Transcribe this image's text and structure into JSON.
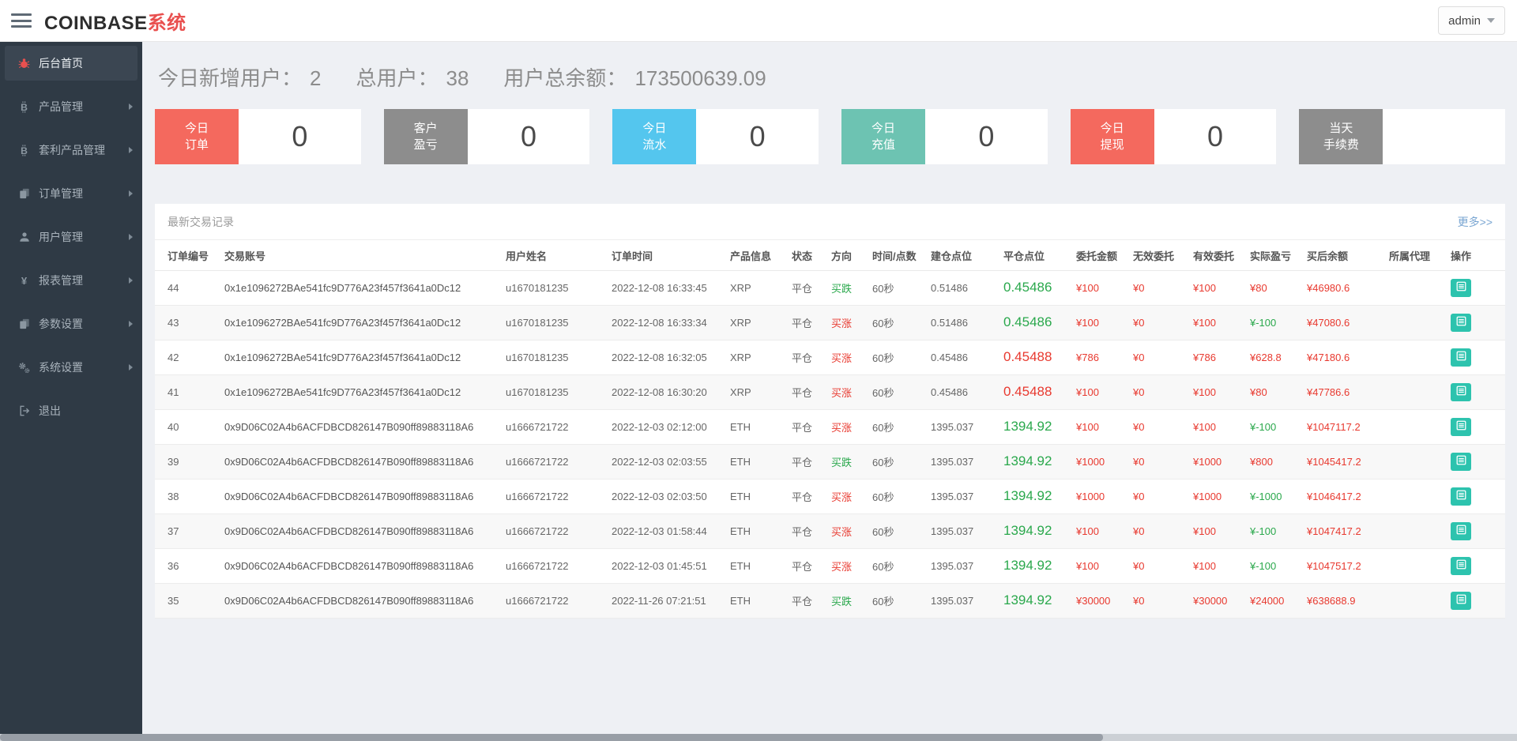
{
  "colors": {
    "accent_red": "#e9504f",
    "cell_red": "#e8392f",
    "cell_green": "#2aa84c",
    "action_teal": "#2dc3ae",
    "link_blue": "#7aa6d2",
    "card_red": "#f4695e",
    "card_gray": "#8d8d8d",
    "card_blue": "#54c6ee",
    "card_teal": "#6dc3b2"
  },
  "header": {
    "brand_main": "COINBASE",
    "brand_suffix": "系统",
    "user_menu_label": "admin"
  },
  "sidebar": {
    "items": [
      {
        "label": "后台首页",
        "icon": "bug-icon",
        "active": true,
        "arrow": false
      },
      {
        "label": "产品管理",
        "icon": "bitcoin-icon",
        "active": false,
        "arrow": true
      },
      {
        "label": "套利产品管理",
        "icon": "bitcoin-icon",
        "active": false,
        "arrow": true
      },
      {
        "label": "订单管理",
        "icon": "copy-icon",
        "active": false,
        "arrow": true
      },
      {
        "label": "用户管理",
        "icon": "user-icon",
        "active": false,
        "arrow": true
      },
      {
        "label": "报表管理",
        "icon": "yen-icon",
        "active": false,
        "arrow": true
      },
      {
        "label": "参数设置",
        "icon": "copy-icon",
        "active": false,
        "arrow": true
      },
      {
        "label": "系统设置",
        "icon": "gear-icon",
        "active": false,
        "arrow": true
      },
      {
        "label": "退出",
        "icon": "logout-icon",
        "active": false,
        "arrow": false
      }
    ]
  },
  "summary": {
    "items": [
      {
        "label": "今日新增用户：",
        "value": "2"
      },
      {
        "label": "总用户：",
        "value": "38"
      },
      {
        "label": "用户总余额：",
        "value": "173500639.09"
      }
    ]
  },
  "cards": [
    {
      "line1": "今日",
      "line2": "订单",
      "value": "0",
      "color": "#f4695e"
    },
    {
      "line1": "客户",
      "line2": "盈亏",
      "value": "0",
      "color": "#8d8d8d"
    },
    {
      "line1": "今日",
      "line2": "流水",
      "value": "0",
      "color": "#54c6ee"
    },
    {
      "line1": "今日",
      "line2": "充值",
      "value": "0",
      "color": "#6dc3b2"
    },
    {
      "line1": "今日",
      "line2": "提现",
      "value": "0",
      "color": "#f4695e"
    },
    {
      "line1": "当天",
      "line2": "手续费",
      "value": "",
      "color": "#8d8d8d"
    }
  ],
  "table": {
    "title": "最新交易记录",
    "more_label": "更多>>",
    "columns": [
      "订单编号",
      "交易账号",
      "用户姓名",
      "订单时间",
      "产品信息",
      "状态",
      "方向",
      "时间/点数",
      "建仓点位",
      "平仓点位",
      "委托金额",
      "无效委托",
      "有效委托",
      "实际盈亏",
      "买后余额",
      "所属代理",
      "操作"
    ],
    "rows": [
      {
        "id": "44",
        "account": "0x1e1096272BAe541fc9D776A23f457f3641a0Dc12",
        "name": "u1670181235",
        "time": "2022-12-08 16:33:45",
        "product": "XRP",
        "status": "平仓",
        "dir": "买跌",
        "dir_color": "green",
        "duration": "60秒",
        "open": "0.51486",
        "close": "0.45486",
        "close_color": "green",
        "amount": "¥100",
        "invalid": "¥0",
        "valid": "¥100",
        "profit": "¥80",
        "profit_color": "red",
        "balance": "¥46980.6",
        "agent": ""
      },
      {
        "id": "43",
        "account": "0x1e1096272BAe541fc9D776A23f457f3641a0Dc12",
        "name": "u1670181235",
        "time": "2022-12-08 16:33:34",
        "product": "XRP",
        "status": "平仓",
        "dir": "买涨",
        "dir_color": "red",
        "duration": "60秒",
        "open": "0.51486",
        "close": "0.45486",
        "close_color": "green",
        "amount": "¥100",
        "invalid": "¥0",
        "valid": "¥100",
        "profit": "¥-100",
        "profit_color": "green",
        "balance": "¥47080.6",
        "agent": ""
      },
      {
        "id": "42",
        "account": "0x1e1096272BAe541fc9D776A23f457f3641a0Dc12",
        "name": "u1670181235",
        "time": "2022-12-08 16:32:05",
        "product": "XRP",
        "status": "平仓",
        "dir": "买涨",
        "dir_color": "red",
        "duration": "60秒",
        "open": "0.45486",
        "close": "0.45488",
        "close_color": "red",
        "amount": "¥786",
        "invalid": "¥0",
        "valid": "¥786",
        "profit": "¥628.8",
        "profit_color": "red",
        "balance": "¥47180.6",
        "agent": ""
      },
      {
        "id": "41",
        "account": "0x1e1096272BAe541fc9D776A23f457f3641a0Dc12",
        "name": "u1670181235",
        "time": "2022-12-08 16:30:20",
        "product": "XRP",
        "status": "平仓",
        "dir": "买涨",
        "dir_color": "red",
        "duration": "60秒",
        "open": "0.45486",
        "close": "0.45488",
        "close_color": "red",
        "amount": "¥100",
        "invalid": "¥0",
        "valid": "¥100",
        "profit": "¥80",
        "profit_color": "red",
        "balance": "¥47786.6",
        "agent": ""
      },
      {
        "id": "40",
        "account": "0x9D06C02A4b6ACFDBCD826147B090ff89883118A6",
        "name": "u1666721722",
        "time": "2022-12-03 02:12:00",
        "product": "ETH",
        "status": "平仓",
        "dir": "买涨",
        "dir_color": "red",
        "duration": "60秒",
        "open": "1395.037",
        "close": "1394.92",
        "close_color": "green",
        "amount": "¥100",
        "invalid": "¥0",
        "valid": "¥100",
        "profit": "¥-100",
        "profit_color": "green",
        "balance": "¥1047117.2",
        "agent": ""
      },
      {
        "id": "39",
        "account": "0x9D06C02A4b6ACFDBCD826147B090ff89883118A6",
        "name": "u1666721722",
        "time": "2022-12-03 02:03:55",
        "product": "ETH",
        "status": "平仓",
        "dir": "买跌",
        "dir_color": "green",
        "duration": "60秒",
        "open": "1395.037",
        "close": "1394.92",
        "close_color": "green",
        "amount": "¥1000",
        "invalid": "¥0",
        "valid": "¥1000",
        "profit": "¥800",
        "profit_color": "red",
        "balance": "¥1045417.2",
        "agent": ""
      },
      {
        "id": "38",
        "account": "0x9D06C02A4b6ACFDBCD826147B090ff89883118A6",
        "name": "u1666721722",
        "time": "2022-12-03 02:03:50",
        "product": "ETH",
        "status": "平仓",
        "dir": "买涨",
        "dir_color": "red",
        "duration": "60秒",
        "open": "1395.037",
        "close": "1394.92",
        "close_color": "green",
        "amount": "¥1000",
        "invalid": "¥0",
        "valid": "¥1000",
        "profit": "¥-1000",
        "profit_color": "green",
        "balance": "¥1046417.2",
        "agent": ""
      },
      {
        "id": "37",
        "account": "0x9D06C02A4b6ACFDBCD826147B090ff89883118A6",
        "name": "u1666721722",
        "time": "2022-12-03 01:58:44",
        "product": "ETH",
        "status": "平仓",
        "dir": "买涨",
        "dir_color": "red",
        "duration": "60秒",
        "open": "1395.037",
        "close": "1394.92",
        "close_color": "green",
        "amount": "¥100",
        "invalid": "¥0",
        "valid": "¥100",
        "profit": "¥-100",
        "profit_color": "green",
        "balance": "¥1047417.2",
        "agent": ""
      },
      {
        "id": "36",
        "account": "0x9D06C02A4b6ACFDBCD826147B090ff89883118A6",
        "name": "u1666721722",
        "time": "2022-12-03 01:45:51",
        "product": "ETH",
        "status": "平仓",
        "dir": "买涨",
        "dir_color": "red",
        "duration": "60秒",
        "open": "1395.037",
        "close": "1394.92",
        "close_color": "green",
        "amount": "¥100",
        "invalid": "¥0",
        "valid": "¥100",
        "profit": "¥-100",
        "profit_color": "green",
        "balance": "¥1047517.2",
        "agent": ""
      },
      {
        "id": "35",
        "account": "0x9D06C02A4b6ACFDBCD826147B090ff89883118A6",
        "name": "u1666721722",
        "time": "2022-11-26 07:21:51",
        "product": "ETH",
        "status": "平仓",
        "dir": "买跌",
        "dir_color": "green",
        "duration": "60秒",
        "open": "1395.037",
        "close": "1394.92",
        "close_color": "green",
        "amount": "¥30000",
        "invalid": "¥0",
        "valid": "¥30000",
        "profit": "¥24000",
        "profit_color": "red",
        "balance": "¥638688.9",
        "agent": ""
      }
    ]
  }
}
